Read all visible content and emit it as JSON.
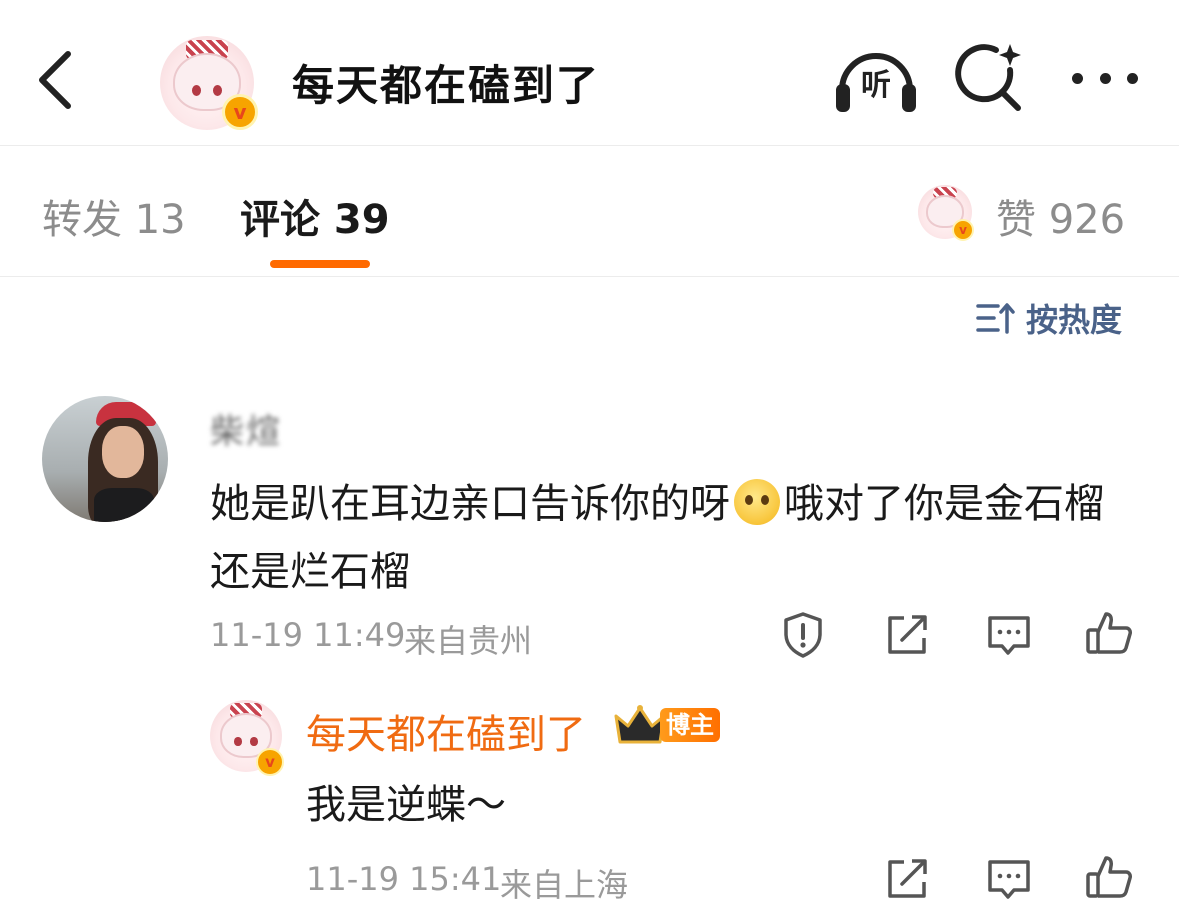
{
  "header": {
    "title": "每天都在磕到了",
    "listen_label": "听"
  },
  "tabs": {
    "repost": "转发 13",
    "comment": "评论 39",
    "like": "赞 926"
  },
  "sort": {
    "label": "按热度"
  },
  "comment": {
    "username": "柴煊",
    "text_before_emoji": "她是趴在耳边亲口告诉你的呀",
    "text_after_emoji": "哦对了你是金石榴还是烂石榴",
    "emoji": "pleading-face-emoji",
    "time": "11-19 11:49",
    "location": "来自贵州"
  },
  "reply": {
    "username": "每天都在磕到了",
    "badge": "博主",
    "text": "我是逆蝶～",
    "time": "11-19 15:41",
    "location": "来自上海"
  },
  "colors": {
    "accent": "#ff6a00",
    "reply_name": "#f06b12",
    "sort_blue": "#4a6289",
    "muted": "#9a9a9a"
  },
  "icons": [
    "back-arrow-icon",
    "headphones-icon",
    "search-sparkle-icon",
    "more-dots-icon",
    "sort-icon",
    "report-icon",
    "share-icon",
    "comment-icon",
    "like-icon",
    "crown-icon",
    "verified-badge-icon"
  ]
}
